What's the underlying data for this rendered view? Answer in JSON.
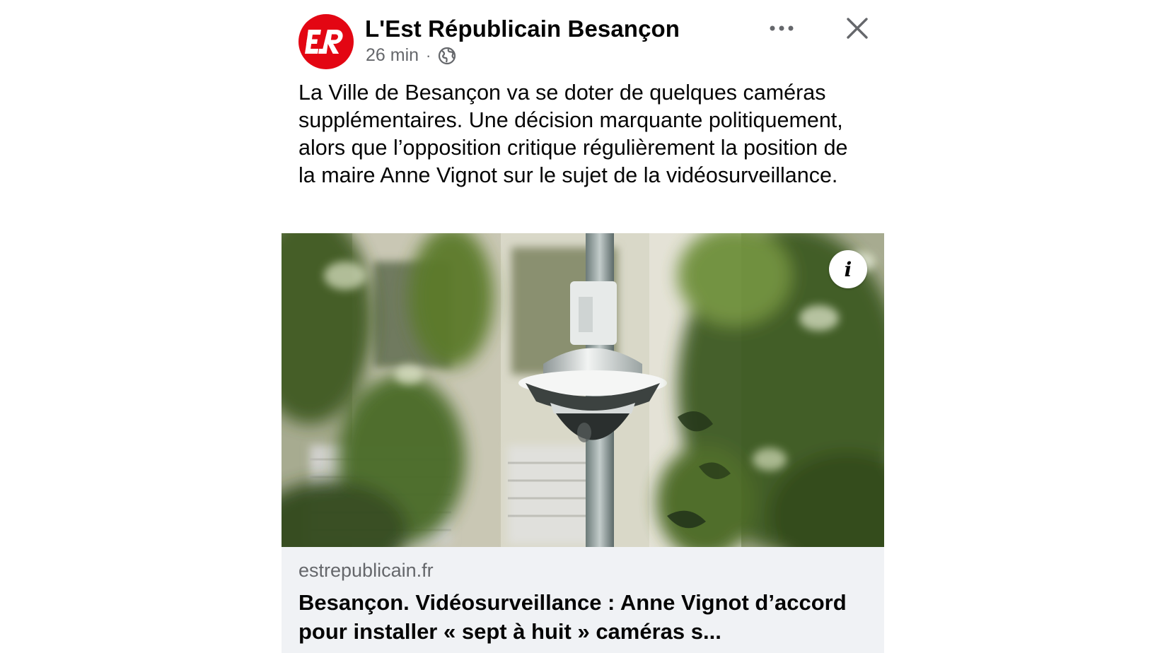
{
  "post": {
    "page_name": "L'Est Républicain Besançon",
    "avatar_text": "ER",
    "time": "26 min",
    "separator": "·",
    "audience_icon": "globe-icon",
    "caption": "La Ville de Besançon va se doter de quelques caméras supplémentaires. Une décision marquante politiquement, alors que l’opposition critique régulièrement la position de la maire Anne Vignot sur le sujet de la vidéosurveillance.",
    "more_icon": "more-dots-icon",
    "close_icon": "close-icon"
  },
  "link": {
    "info_label": "i",
    "domain": "estrepublicain.fr",
    "headline": "Besançon. Vidéosurveillance : Anne Vignot d’accord pour installer « sept à huit » caméras s..."
  },
  "colors": {
    "brand_red": "#e30613",
    "secondary_text": "#65676b",
    "footer_bg": "#f0f2f5"
  }
}
